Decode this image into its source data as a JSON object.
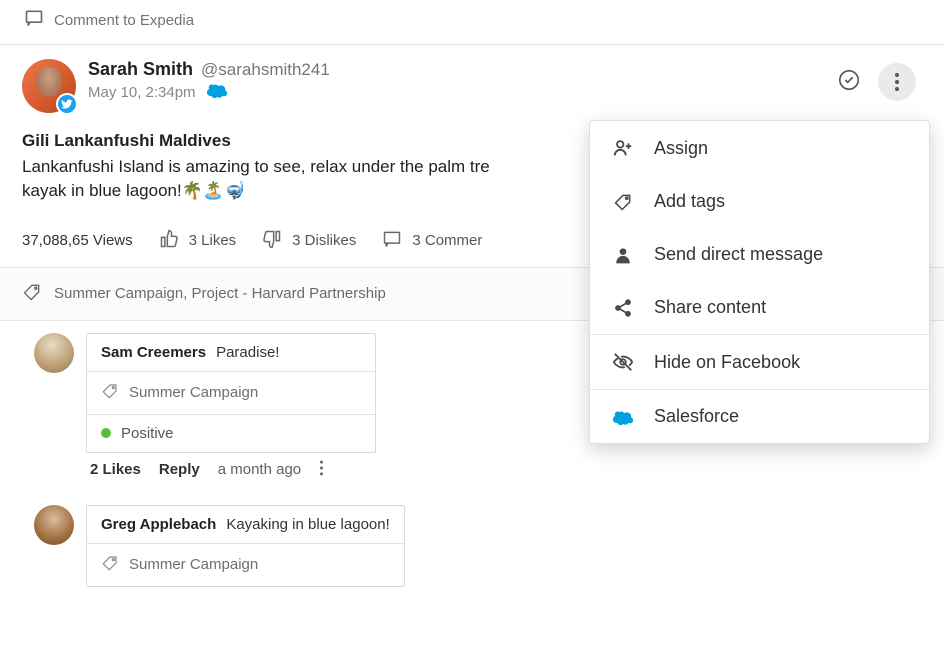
{
  "topbar": {
    "label": "Comment to Expedia"
  },
  "post": {
    "author_name": "Sarah Smith",
    "author_handle": "@sarahsmith241",
    "timestamp": "May 10, 2:34pm",
    "title": "Gili Lankanfushi Maldives",
    "text_line1": "Lankanfushi Island is amazing to see, relax under the palm tre",
    "text_line2": "kayak in blue lagoon!🌴🏝️🤿",
    "views": "37,088,65 Views",
    "likes": "3 Likes",
    "dislikes": "3 Dislikes",
    "comments_count": "3 Commer",
    "tags_text": "Summer Campaign, Project - Harvard Partnership"
  },
  "comments": {
    "c1": {
      "author": "Sam Creemers",
      "text": "Paradise!",
      "tag": "Summer Campaign",
      "sentiment": "Positive",
      "likes": "2 Likes",
      "reply_label": "Reply",
      "time": "a month ago"
    },
    "c2": {
      "author": "Greg Applebach",
      "text": "Kayaking in blue lagoon!",
      "tag": "Summer Campaign"
    }
  },
  "menu": {
    "assign": "Assign",
    "add_tags": "Add tags",
    "send_dm": "Send direct message",
    "share": "Share content",
    "hide_fb": "Hide on Facebook",
    "salesforce": "Salesforce"
  }
}
